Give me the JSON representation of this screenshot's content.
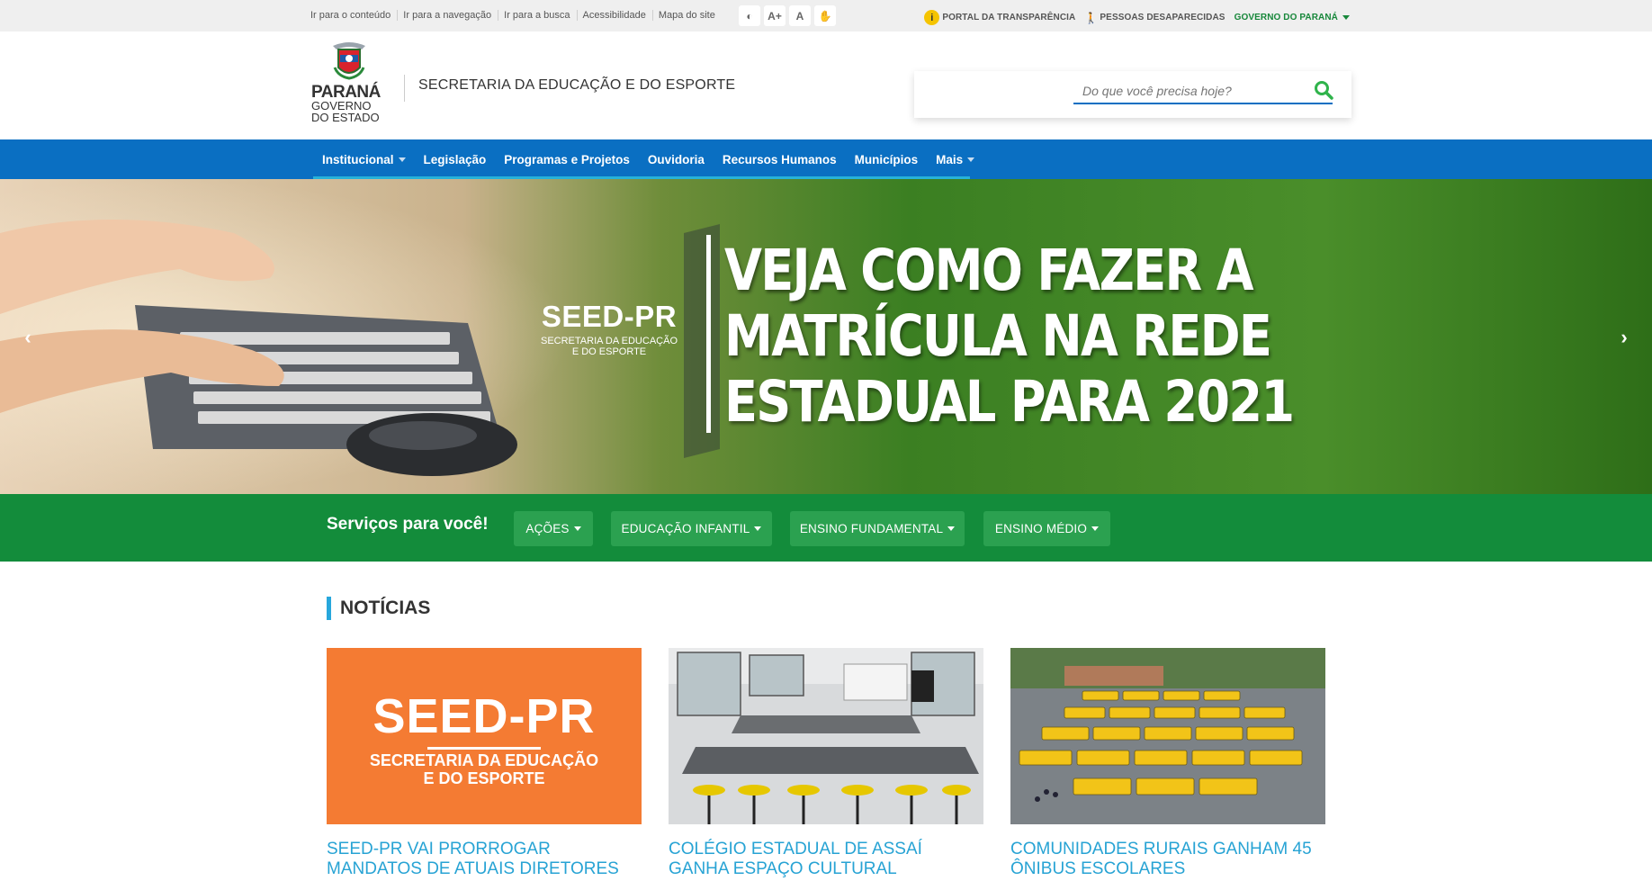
{
  "utility": {
    "skip_links": [
      "Ir para o conteúdo",
      "Ir para a navegação",
      "Ir para a busca",
      "Acessibilidade",
      "Mapa do site"
    ],
    "a11y_buttons": [
      "◐",
      "A+",
      "A",
      "✋"
    ],
    "transparencia": "PORTAL DA TRANSPARÊNCIA",
    "desaparecidas": "PESSOAS DESAPARECIDAS",
    "governo": "GOVERNO DO PARANÁ"
  },
  "header": {
    "logo_name": "PARANÁ",
    "logo_sub1": "GOVERNO",
    "logo_sub2": "DO ESTADO",
    "secretaria": "SECRETARIA DA EDUCAÇÃO E DO ESPORTE",
    "search_placeholder": "Do que você precisa hoje?"
  },
  "nav": {
    "items": [
      "Institucional",
      "Legislação",
      "Programas e Projetos",
      "Ouvidoria",
      "Recursos Humanos",
      "Municípios",
      "Mais"
    ]
  },
  "banner": {
    "seed_title": "SEED-PR",
    "seed_sub1": "SECRETARIA DA EDUCAÇÃO",
    "seed_sub2": "E DO ESPORTE",
    "headline": [
      "VEJA COMO FAZER A",
      "MATRÍCULA NA REDE",
      "ESTADUAL PARA 2021"
    ],
    "prev_arrow": "‹",
    "next_arrow": "›"
  },
  "services": {
    "title": "Serviços para você!",
    "buttons": [
      "AÇÕES",
      "EDUCAÇÃO INFANTIL",
      "ENSINO FUNDAMENTAL",
      "ENSINO MÉDIO"
    ]
  },
  "news": {
    "heading": "NOTÍCIAS",
    "seed_card_title": "SEED-PR",
    "seed_card_sub1": "SECRETARIA DA EDUCAÇÃO",
    "seed_card_sub2": "E DO ESPORTE",
    "cards": [
      {
        "title_line1": "SEED-PR VAI PRORROGAR",
        "title_line2": "MANDATOS DE ATUAIS DIRETORES"
      },
      {
        "title_line1": "COLÉGIO ESTADUAL DE ASSAÍ",
        "title_line2": "GANHA ESPAÇO CULTURAL"
      },
      {
        "title_line1": "COMUNIDADES RURAIS GANHAM 45",
        "title_line2": "ÔNIBUS ESCOLARES"
      }
    ]
  },
  "colors": {
    "nav_blue": "#0a6fc2",
    "services_green": "#138c3b",
    "news_title": "#27a3d4",
    "seed_orange": "#f47b33"
  }
}
